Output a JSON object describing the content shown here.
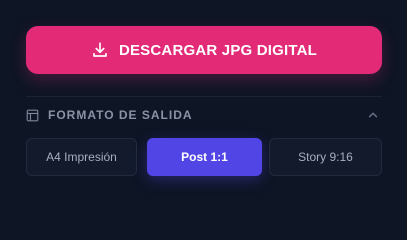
{
  "download": {
    "label": "DESCARGAR JPG DIGITAL",
    "icon": "download-icon",
    "color": "#e22a77"
  },
  "output_section": {
    "icon": "layout-icon",
    "title": "FORMATO DE SALIDA",
    "collapse_icon": "chevron-up-icon",
    "formats": [
      {
        "label": "A4 Impresión",
        "selected": false
      },
      {
        "label": "Post 1:1",
        "selected": true
      },
      {
        "label": "Story 9:16",
        "selected": false
      }
    ],
    "accent": "#5146e5"
  }
}
